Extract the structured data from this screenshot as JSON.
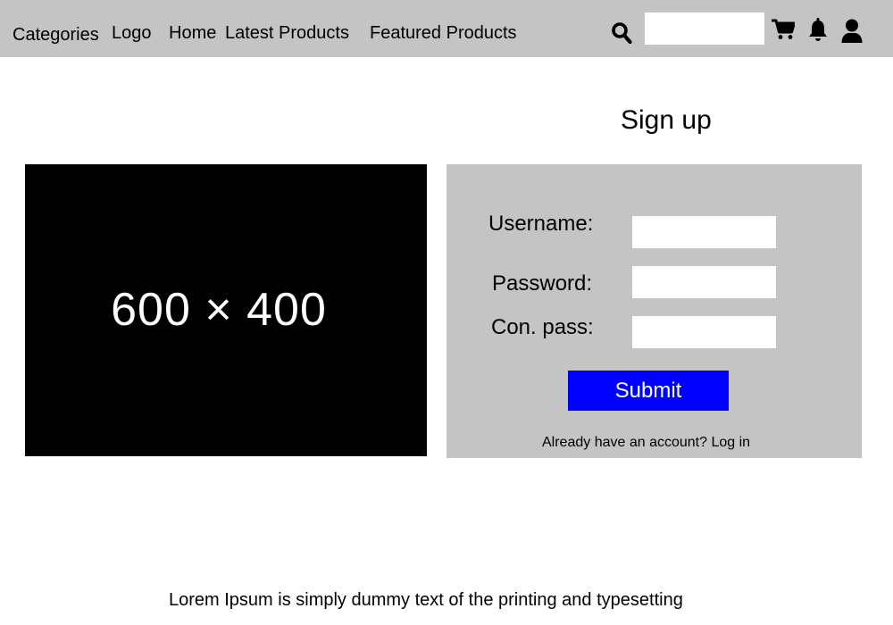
{
  "header": {
    "nav": {
      "categories": "Categories",
      "logo": "Logo",
      "home": "Home",
      "latest_products": "Latest Products",
      "featured_products": "Featured Products"
    },
    "search": {
      "value": "",
      "placeholder": "",
      "icon": "search-icon"
    },
    "icons": {
      "cart": "cart-icon",
      "notifications": "bell-icon",
      "account": "user-icon"
    },
    "background_color": "#c4c4c4"
  },
  "signup": {
    "title": "Sign up",
    "image_placeholder_text": "600 × 400",
    "form": {
      "username_label": "Username:",
      "username_value": "",
      "password_label": "Password:",
      "password_value": "",
      "confirm_password_label": "Con. pass:",
      "confirm_password_value": "",
      "submit_label": "Submit",
      "login_prompt": "Already have an account?",
      "login_link": "Log in"
    },
    "panel_color": "#c4c4c4",
    "submit_color": "#0000ff"
  },
  "footer": {
    "lorem": "Lorem Ipsum is simply dummy text of the printing and typesetting"
  }
}
